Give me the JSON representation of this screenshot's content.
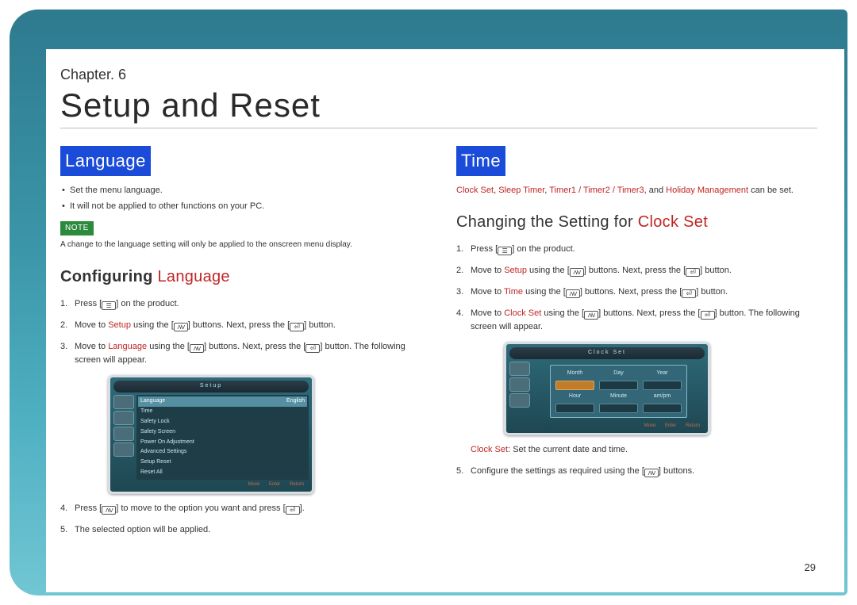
{
  "chapter_label": "Chapter. 6",
  "chapter_title": "Setup and Reset",
  "page_number": "29",
  "left": {
    "section_title": "Language",
    "bullets": [
      "Set the menu language.",
      "It will not be applied to other functions on your PC."
    ],
    "note_label": "NOTE",
    "note_text": "A change to the language setting will only be applied to the onscreen menu display.",
    "subheading_bold": "Configuring",
    "subheading_hl": "Language",
    "steps": {
      "s1a": "Press [",
      "s1b": "] on the product.",
      "s2a": "Move to ",
      "s2hl": "Setup",
      "s2b": " using the [",
      "s2c": "] buttons. Next, press the [",
      "s2d": "] button.",
      "s3a": "Move to ",
      "s3hl": "Language",
      "s3b": " using the [",
      "s3c": "] buttons. Next, press the [",
      "s3d": "] button. The following screen will appear.",
      "s4a": "Press [",
      "s4b": "] to move to the option you want and press [",
      "s4c": "].",
      "s5": "The selected option will be applied."
    },
    "shot": {
      "title": "Setup",
      "menu_items": [
        [
          "Language",
          "English"
        ],
        [
          "Time",
          ""
        ],
        [
          "Safety Lock",
          ""
        ],
        [
          "Safety Screen",
          ""
        ],
        [
          "Power On Adjustment",
          ""
        ],
        [
          "Advanced Settings",
          ""
        ],
        [
          "Setup Reset",
          ""
        ],
        [
          "Reset All",
          ""
        ]
      ],
      "footer": [
        "Move",
        "Enter",
        "Return"
      ]
    }
  },
  "right": {
    "section_title": "Time",
    "intro": {
      "a": "Clock Set",
      "b": ", ",
      "c": "Sleep Timer",
      "d": ", ",
      "e": "Timer1 / Timer2 / Timer3",
      "f": ", and ",
      "g": "Holiday Management",
      "h": " can be set."
    },
    "subheading_plain": "Changing the Setting for ",
    "subheading_hl": "Clock Set",
    "steps": {
      "s1a": "Press [",
      "s1b": "] on the product.",
      "s2a": "Move to ",
      "s2hl": "Setup",
      "s2b": " using the [",
      "s2c": "] buttons. Next, press the [",
      "s2d": "] button.",
      "s3a": "Move to ",
      "s3hl": "Time",
      "s3b": " using the [",
      "s3c": "] buttons. Next, press the [",
      "s3d": "] button.",
      "s4a": "Move to ",
      "s4hl": "Clock Set",
      "s4b": " using the [",
      "s4c": "] buttons. Next, press the [",
      "s4d": "] button. The following screen will appear.",
      "s5": "Configure the settings as required using the [",
      "s5b": "] buttons."
    },
    "shot": {
      "title": "Clock Set",
      "headers_top": [
        "Month",
        "Day",
        "Year"
      ],
      "headers_bot": [
        "Hour",
        "Minute",
        "am/pm"
      ],
      "footer": [
        "Move",
        "Enter",
        "Return"
      ]
    },
    "caption_hl": "Clock Set",
    "caption_rest": ": Set the current date and time."
  }
}
